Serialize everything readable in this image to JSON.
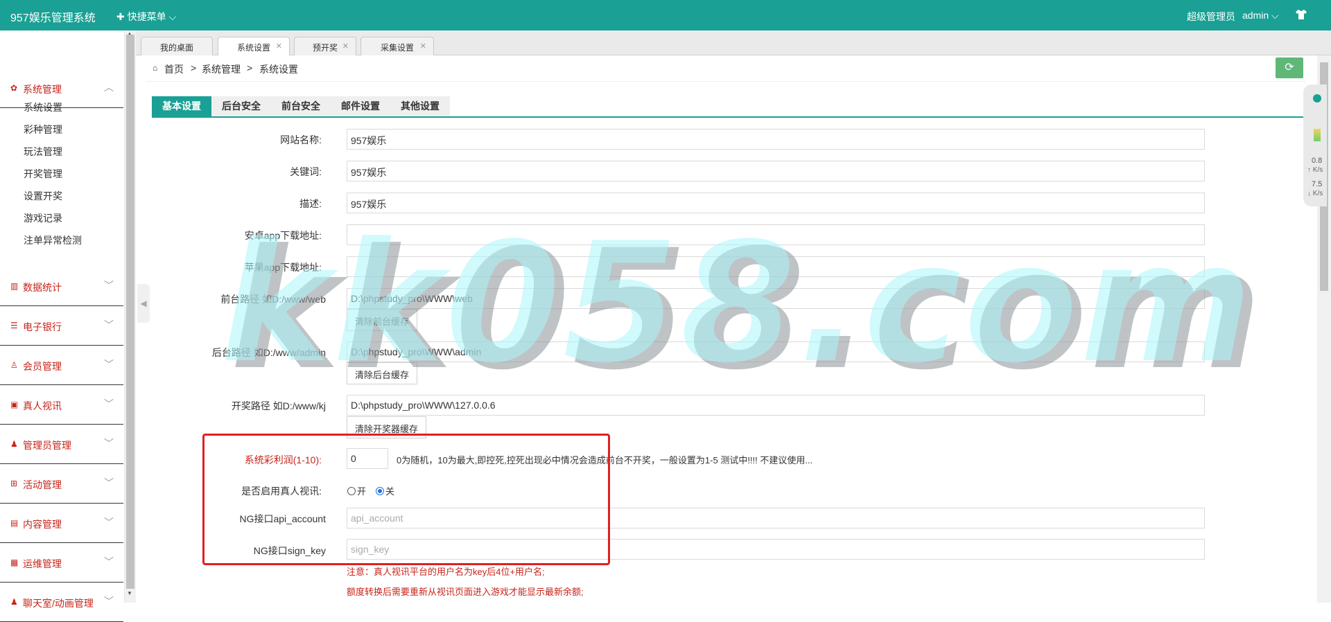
{
  "app": {
    "title": "957娱乐管理系统",
    "quick_menu": "✚ 快捷菜单 ⌵",
    "role": "超级管理员",
    "user": "admin ⌵"
  },
  "colors": {
    "primary": "#1aa094",
    "accent_red": "#c7231a",
    "highlight_box": "#e02020",
    "refresh": "#5fb878"
  },
  "sidebar": {
    "menus": [
      {
        "label": "系统管理",
        "icon": "gear-icon",
        "chevron": "︿"
      },
      {
        "label": "数据统计",
        "icon": "bar-chart-icon",
        "chevron": "﹀"
      },
      {
        "label": "电子银行",
        "icon": "list-icon",
        "chevron": "﹀"
      },
      {
        "label": "会员管理",
        "icon": "user-icon",
        "chevron": "﹀"
      },
      {
        "label": "真人视讯",
        "icon": "video-icon",
        "chevron": "﹀"
      },
      {
        "label": "管理员管理",
        "icon": "admin-icon",
        "chevron": "﹀"
      },
      {
        "label": "活动管理",
        "icon": "gift-icon",
        "chevron": "﹀"
      },
      {
        "label": "内容管理",
        "icon": "content-icon",
        "chevron": "﹀"
      },
      {
        "label": "运维管理",
        "icon": "server-icon",
        "chevron": "﹀"
      },
      {
        "label": "聊天室/动画管理",
        "icon": "chat-icon",
        "chevron": "﹀"
      }
    ],
    "subitems": [
      "系统设置",
      "彩种管理",
      "玩法管理",
      "开奖管理",
      "设置开奖",
      "游戏记录",
      "注单异常检测"
    ]
  },
  "page_tabs": [
    {
      "label": "我的桌面",
      "close": ""
    },
    {
      "label": "系统设置",
      "close": "✕"
    },
    {
      "label": "预开奖",
      "close": "✕"
    },
    {
      "label": "采集设置",
      "close": "✕"
    }
  ],
  "breadcrumb": {
    "home": "首页",
    "sep": ">",
    "level1": "系统管理",
    "level2": "系统设置"
  },
  "refresh_icon": "⟳",
  "settings_tabs": [
    "基本设置",
    "后台安全",
    "前台安全",
    "邮件设置",
    "其他设置"
  ],
  "widget": {
    "up_value": "0.8",
    "up_unit": "↑ K/s",
    "down_value": "7.5",
    "down_unit": "↓ K/s"
  },
  "form": {
    "site_name": {
      "label": "网站名称:",
      "value": "957娱乐"
    },
    "keywords": {
      "label": "关键词:",
      "value": "957娱乐"
    },
    "description": {
      "label": "描述:",
      "value": "957娱乐"
    },
    "android_url": {
      "label": "安卓app下载地址:",
      "value": ""
    },
    "ios_url": {
      "label": "苹果app下载地址:",
      "value": ""
    },
    "front_path": {
      "label": "前台路径 如D:/www/web",
      "value": "D:\\phpstudy_pro\\WWW\\web",
      "button": "清除前台缓存"
    },
    "admin_path": {
      "label": "后台路径 如D:/www/admin",
      "value": "D:\\phpstudy_pro\\WWW\\admin",
      "button": "清除后台缓存"
    },
    "kj_path": {
      "label": "开奖路径 如D:/www/kj",
      "value": "D:\\phpstudy_pro\\WWW\\127.0.0.6",
      "button": "清除开奖器缓存"
    },
    "profit": {
      "label": "系统彩利润(1-10):",
      "value": "0",
      "hint": "0为随机，10为最大,即控死,控死出现必中情况会造成前台不开奖，一般设置为1-5 测试中!!!! 不建议使用..."
    },
    "live_video": {
      "label": "是否启用真人视讯:",
      "on": "开",
      "off": "关",
      "selected": "off"
    },
    "ng_account": {
      "label": "NG接口api_account",
      "placeholder": "api_account"
    },
    "ng_sign": {
      "label": "NG接口sign_key",
      "placeholder": "sign_key"
    },
    "note1": "注意：真人视讯平台的用户名为key后4位+用户名;",
    "note2": "额度转换后需要重新从视讯页面进入游戏才能显示最新余额;"
  },
  "watermark": "kk058.com"
}
